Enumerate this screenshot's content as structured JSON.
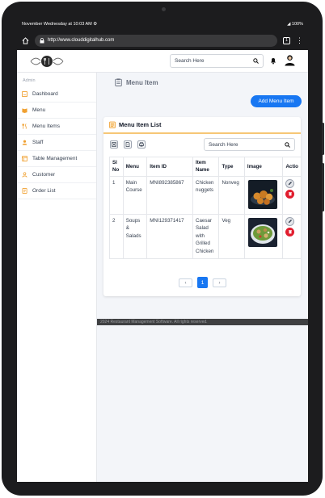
{
  "statusbar": {
    "datetime": "November Wednesday at 10:03 AM",
    "battery": "100%"
  },
  "browser": {
    "url": "http://www.clouddigitalhub.com",
    "tab_count": "1"
  },
  "header": {
    "search_placeholder": "Search Here"
  },
  "sidebar": {
    "section": "Admin",
    "items": [
      {
        "label": "Dashboard",
        "icon": "dashboard-icon"
      },
      {
        "label": "Menu",
        "icon": "menu-book-icon"
      },
      {
        "label": "Menu Items",
        "icon": "fork-knife-icon"
      },
      {
        "label": "Staff",
        "icon": "staff-icon"
      },
      {
        "label": "Table Management",
        "icon": "table-icon"
      },
      {
        "label": "Customer",
        "icon": "customer-icon"
      },
      {
        "label": "Order List",
        "icon": "order-icon"
      }
    ]
  },
  "page": {
    "title": "Menu Item",
    "add_button": "Add Menu Item"
  },
  "card": {
    "title": "Menu Item List",
    "search_placeholder": "Search Here",
    "columns": {
      "sl": [
        "Sl",
        "No"
      ],
      "menu": "Menu",
      "item_id": "Item ID",
      "item_name": [
        "Item",
        "Name"
      ],
      "type": "Type",
      "image": "Image",
      "action": "Actio"
    },
    "rows": [
      {
        "sl": "1",
        "menu": [
          "Main",
          "Course"
        ],
        "item_id": "MNI892385867",
        "item_name": [
          "Chicken",
          "nuggets"
        ],
        "type": "Nonveg"
      },
      {
        "sl": "2",
        "menu": [
          "Soups",
          "&",
          "Salads"
        ],
        "item_id": "MNI129371417",
        "item_name": [
          "Caesar",
          "Salad",
          "with",
          "Grilled",
          "Chicken"
        ],
        "type": "Veg"
      }
    ],
    "pagination": {
      "prev": "‹",
      "current": "1",
      "next": "›"
    }
  },
  "footer": {
    "text": "2024 Restaurant Management Software. All rights reserved."
  },
  "colors": {
    "primary": "#1877f2",
    "danger": "#e11d2e",
    "card_accent": "#f6c776",
    "sidebar_icon": "#f0a030"
  }
}
